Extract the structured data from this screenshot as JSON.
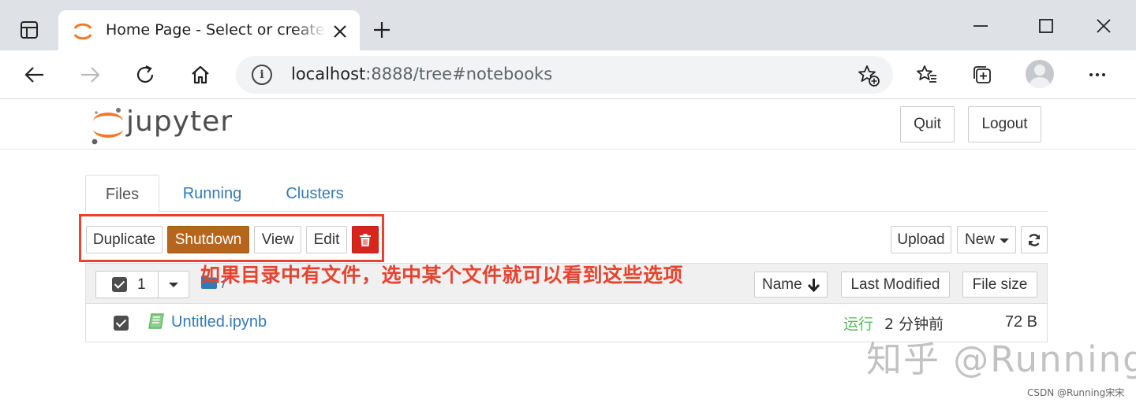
{
  "browser": {
    "tab_title": "Home Page - Select or create a notebook",
    "url_host": "localhost",
    "url_rest": ":8888/tree#notebooks"
  },
  "header": {
    "logo_text": "jupyter",
    "quit_label": "Quit",
    "logout_label": "Logout"
  },
  "tabs": [
    {
      "label": "Files",
      "active": true
    },
    {
      "label": "Running",
      "active": false
    },
    {
      "label": "Clusters",
      "active": false
    }
  ],
  "actions": {
    "duplicate": "Duplicate",
    "shutdown": "Shutdown",
    "view": "View",
    "edit": "Edit",
    "upload": "Upload",
    "new": "New"
  },
  "list_header": {
    "selected_count": "1",
    "breadcrumb": "/",
    "sort_name": "Name",
    "sort_modified": "Last Modified",
    "sort_size": "File size"
  },
  "files": [
    {
      "name": "Untitled.ipynb",
      "status": "运行",
      "modified": "2 分钟前",
      "size": "72 B",
      "checked": true
    }
  ],
  "annotation": "如果目录中有文件，选中某个文件就可以看到这些选项",
  "watermark": "知乎 @Running",
  "credit": "CSDN @Running宋宋",
  "colors": {
    "shutdown_bg": "#b5651d",
    "delete_bg": "#d9261c",
    "annotation_red": "#e8432f",
    "link_blue": "#337ab7",
    "running_green": "#5cb85c",
    "jupyter_orange": "#f37726"
  }
}
